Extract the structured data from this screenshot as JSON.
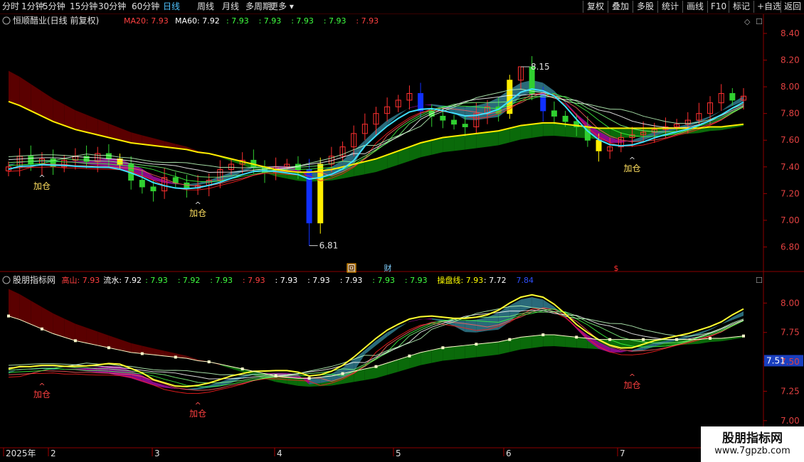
{
  "toolbar": {
    "left": [
      "分时",
      "1分钟",
      "5分钟",
      "15分钟",
      "30分钟",
      "60分钟",
      "日线",
      "周线",
      "月线",
      "多周期",
      "更多"
    ],
    "active": "日线",
    "right": [
      "复权",
      "叠加",
      "多股",
      "统计",
      "画线",
      "F10",
      "标记",
      "+自选",
      "返回"
    ]
  },
  "main_panel": {
    "title": "恒顺醋业(日线 前复权)",
    "legend": [
      {
        "text": "MA20: 7.93",
        "color": "#ff4040"
      },
      {
        "text": "MA60: 7.92",
        "color": "#ffffff"
      },
      {
        "text": ": 7.93",
        "color": "#40ff40"
      },
      {
        "text": ": 7.93",
        "color": "#40ff40"
      },
      {
        "text": ": 7.93",
        "color": "#40ff40"
      },
      {
        "text": ": 7.93",
        "color": "#40ff40"
      },
      {
        "text": ": 7.93",
        "color": "#ff4040"
      }
    ],
    "high_label": "8.15",
    "low_label": "6.81",
    "markers": [
      "回",
      "财",
      "$"
    ]
  },
  "sub_panel": {
    "title": "股朋指标网",
    "legend": [
      {
        "text": "高山: 7.93",
        "color": "#ff4040"
      },
      {
        "text": "流水: 7.92",
        "color": "#ffffff"
      },
      {
        "text": ": 7.93",
        "color": "#40ff40"
      },
      {
        "text": ": 7.92",
        "color": "#40ff40"
      },
      {
        "text": ": 7.93",
        "color": "#40ff40"
      },
      {
        "text": ": 7.93",
        "color": "#ff4040"
      },
      {
        "text": ": 7.93",
        "color": "#ffffff"
      },
      {
        "text": ": 7.93",
        "color": "#ffffff"
      },
      {
        "text": ": 7.93",
        "color": "#ffffff"
      },
      {
        "text": ": 7.93",
        "color": "#40ff40"
      },
      {
        "text": ": 7.93",
        "color": "#40ff40"
      },
      {
        "text": "操盘线: 7.93",
        "color": "#ffff00"
      },
      {
        "text": ": 7.72",
        "color": "#ffffff"
      },
      {
        "text": "7.84",
        "color": "#3050ff"
      }
    ],
    "cursor_value": "7.51"
  },
  "signals": {
    "main": [
      "加仓",
      "加仓",
      "加仓"
    ],
    "sub": [
      "加仓",
      "加仓",
      "加仓"
    ]
  },
  "watermark": {
    "title": "股朋指标网",
    "url": "www.7gpzb.com"
  },
  "chart_data": [
    {
      "type": "candlestick",
      "y_ticks": [
        "8.40",
        "8.20",
        "8.00",
        "7.80",
        "7.60",
        "7.40",
        "7.20",
        "7.00",
        "6.80"
      ],
      "ylim": [
        6.68,
        8.48
      ],
      "x_ticks": [
        "2025年",
        "2",
        "3",
        "4",
        "5",
        "6",
        "7"
      ],
      "series": [
        {
          "name": "MA20",
          "values": [
            7.42,
            7.43,
            7.44,
            7.45,
            7.45,
            7.44,
            7.43,
            7.42,
            7.41,
            7.4,
            7.38,
            7.36,
            7.33,
            7.3,
            7.28,
            7.27,
            7.27,
            7.28,
            7.3,
            7.33,
            7.36,
            7.38,
            7.4,
            7.4,
            7.39,
            7.37,
            7.36,
            7.36,
            7.37,
            7.4,
            7.45,
            7.52,
            7.6,
            7.68,
            7.75,
            7.8,
            7.84,
            7.86,
            7.87,
            7.86,
            7.85,
            7.85,
            7.86,
            7.88,
            7.92,
            7.98,
            8.03,
            8.05,
            8.03,
            7.97,
            7.88,
            7.78,
            7.68,
            7.61,
            7.58,
            7.58,
            7.6,
            7.63,
            7.66,
            7.68,
            7.7,
            7.72,
            7.75,
            7.78,
            7.82,
            7.88,
            7.93
          ]
        },
        {
          "name": "MA60",
          "values": [
            7.89,
            7.86,
            7.82,
            7.78,
            7.74,
            7.71,
            7.68,
            7.66,
            7.64,
            7.62,
            7.6,
            7.58,
            7.57,
            7.56,
            7.55,
            7.54,
            7.53,
            7.51,
            7.5,
            7.48,
            7.46,
            7.44,
            7.42,
            7.4,
            7.38,
            7.37,
            7.36,
            7.36,
            7.37,
            7.38,
            7.4,
            7.42,
            7.44,
            7.46,
            7.49,
            7.52,
            7.55,
            7.58,
            7.6,
            7.62,
            7.63,
            7.64,
            7.65,
            7.66,
            7.67,
            7.69,
            7.71,
            7.72,
            7.73,
            7.73,
            7.72,
            7.71,
            7.7,
            7.69,
            7.69,
            7.69,
            7.69,
            7.69,
            7.69,
            7.69,
            7.69,
            7.69,
            7.69,
            7.7,
            7.7,
            7.71,
            7.72
          ]
        },
        {
          "name": "close",
          "values": [
            7.4,
            7.48,
            7.42,
            7.46,
            7.4,
            7.45,
            7.48,
            7.44,
            7.5,
            7.46,
            7.42,
            7.3,
            7.25,
            7.22,
            7.32,
            7.28,
            7.24,
            7.26,
            7.3,
            7.38,
            7.42,
            7.45,
            7.4,
            7.36,
            7.4,
            7.42,
            7.38,
            6.98,
            7.42,
            7.48,
            7.55,
            7.65,
            7.72,
            7.8,
            7.85,
            7.9,
            7.95,
            7.82,
            7.78,
            7.75,
            7.72,
            7.7,
            7.8,
            7.85,
            7.8,
            8.05,
            8.15,
            7.95,
            7.82,
            7.78,
            7.74,
            7.7,
            7.6,
            7.52,
            7.55,
            7.62,
            7.64,
            7.66,
            7.68,
            7.7,
            7.72,
            7.75,
            7.8,
            7.88,
            7.95,
            7.9,
            7.93
          ]
        }
      ]
    },
    {
      "type": "line",
      "y_ticks": [
        "8.00",
        "7.75",
        "7.50",
        "7.25",
        "7.00"
      ],
      "ylim": [
        6.89,
        8.22
      ]
    }
  ]
}
